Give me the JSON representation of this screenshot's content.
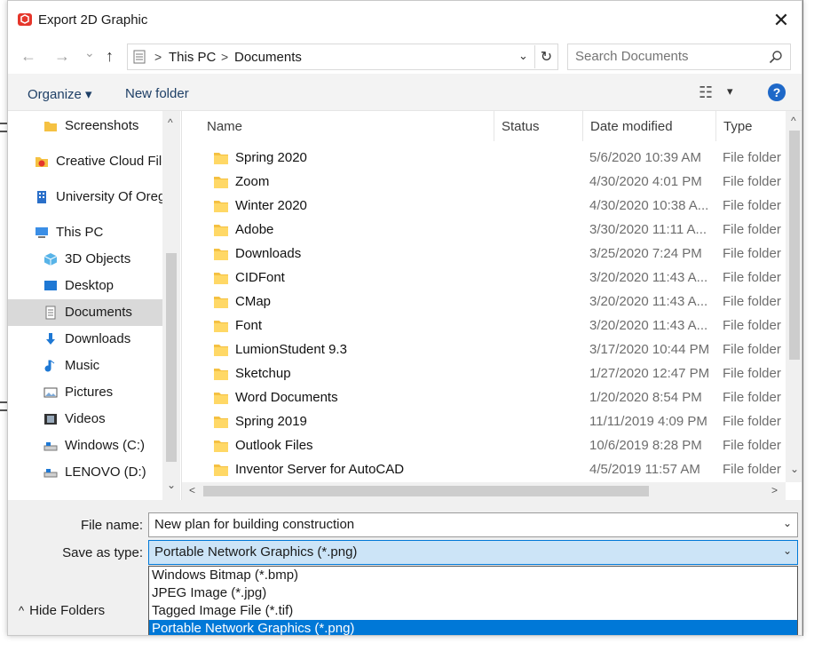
{
  "window": {
    "title": "Export 2D Graphic",
    "close_glyph": "✕"
  },
  "nav": {
    "back_glyph": "←",
    "forward_glyph": "→",
    "recent_glyph": "⌄",
    "up_glyph": "↑",
    "breadcrumbs": [
      "This PC",
      "Documents"
    ],
    "crumb_sep": ">",
    "refresh_glyph": "↻",
    "dropdown_glyph": "⌄",
    "search_placeholder": "Search Documents"
  },
  "toolbar": {
    "organize_label": "Organize ▾",
    "new_folder_label": "New folder",
    "view_glyph": "☷",
    "view_dd": "▾",
    "help_label": "?"
  },
  "sidebar": {
    "items": [
      {
        "label": "Screenshots",
        "icon": "folder-icon"
      },
      {
        "label": "Creative Cloud Files",
        "icon": "creative-cloud-icon"
      },
      {
        "label": "University Of Oregon",
        "icon": "building-icon"
      },
      {
        "label": "This PC",
        "icon": "computer-icon"
      },
      {
        "label": "3D Objects",
        "icon": "cube-icon"
      },
      {
        "label": "Desktop",
        "icon": "desktop-icon"
      },
      {
        "label": "Documents",
        "icon": "documents-icon",
        "selected": true
      },
      {
        "label": "Downloads",
        "icon": "download-icon"
      },
      {
        "label": "Music",
        "icon": "music-icon"
      },
      {
        "label": "Pictures",
        "icon": "pictures-icon"
      },
      {
        "label": "Videos",
        "icon": "videos-icon"
      },
      {
        "label": "Windows (C:)",
        "icon": "drive-icon"
      },
      {
        "label": "LENOVO (D:)",
        "icon": "drive-icon"
      }
    ],
    "scroll_up": "^",
    "scroll_down": "⌄"
  },
  "columns": {
    "name": "Name",
    "status": "Status",
    "date": "Date modified",
    "type": "Type"
  },
  "files": [
    {
      "name": "Spring 2020",
      "date": "5/6/2020 10:39 AM",
      "type": "File folder"
    },
    {
      "name": "Zoom",
      "date": "4/30/2020 4:01 PM",
      "type": "File folder"
    },
    {
      "name": "Winter 2020",
      "date": "4/30/2020 10:38 A...",
      "type": "File folder"
    },
    {
      "name": "Adobe",
      "date": "3/30/2020 11:11 A...",
      "type": "File folder"
    },
    {
      "name": "Downloads",
      "date": "3/25/2020 7:24 PM",
      "type": "File folder"
    },
    {
      "name": "CIDFont",
      "date": "3/20/2020 11:43 A...",
      "type": "File folder"
    },
    {
      "name": "CMap",
      "date": "3/20/2020 11:43 A...",
      "type": "File folder"
    },
    {
      "name": "Font",
      "date": "3/20/2020 11:43 A...",
      "type": "File folder"
    },
    {
      "name": "LumionStudent 9.3",
      "date": "3/17/2020 10:44 PM",
      "type": "File folder"
    },
    {
      "name": "Sketchup",
      "date": "1/27/2020 12:47 PM",
      "type": "File folder"
    },
    {
      "name": "Word Documents",
      "date": "1/20/2020 8:54 PM",
      "type": "File folder"
    },
    {
      "name": "Spring 2019",
      "date": "11/11/2019 4:09 PM",
      "type": "File folder"
    },
    {
      "name": "Outlook Files",
      "date": "10/6/2019 8:28 PM",
      "type": "File folder"
    },
    {
      "name": "Inventor Server for AutoCAD",
      "date": "4/5/2019 11:57 AM",
      "type": "File folder"
    }
  ],
  "scroll": {
    "up": "^",
    "down": "⌄",
    "left": "<",
    "right": ">"
  },
  "form": {
    "filename_label": "File name:",
    "filename_value": "New plan for building construction",
    "savetype_label": "Save as type:",
    "savetype_value": "Portable Network Graphics (*.png)",
    "dd_glyph": "⌄",
    "options": [
      "Windows Bitmap (*.bmp)",
      "JPEG Image (*.jpg)",
      "Tagged Image File (*.tif)",
      "Portable Network Graphics (*.png)"
    ],
    "hide_folders_label": "Hide Folders",
    "hide_glyph": "^"
  },
  "colors": {
    "accent": "#0078d7",
    "folder": "#f5c142",
    "help": "#1e68c8",
    "selected_side": "#d9d9d9"
  }
}
